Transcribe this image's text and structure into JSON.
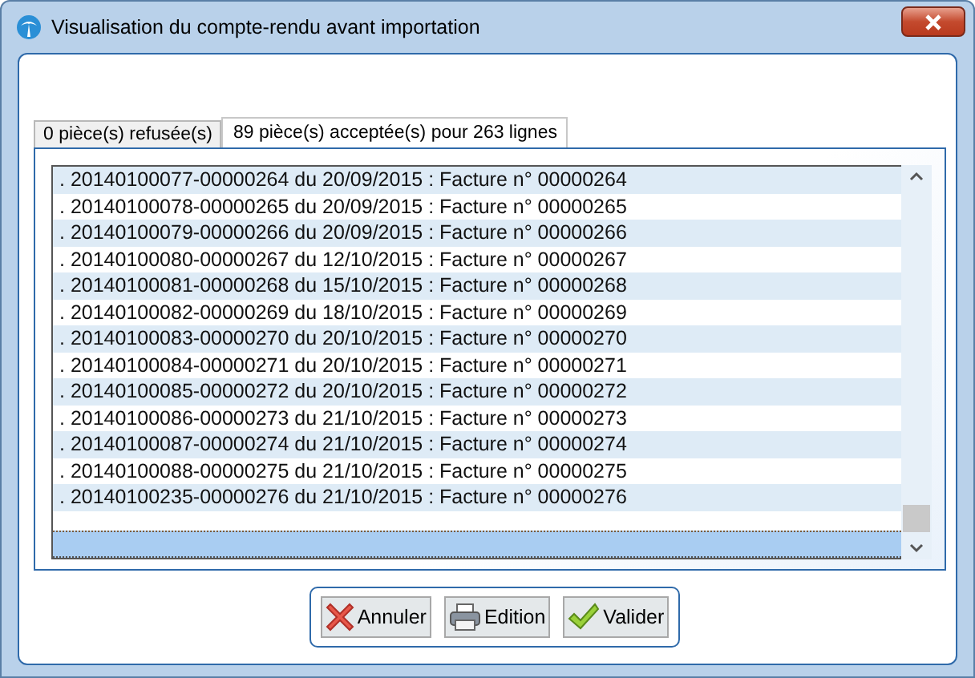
{
  "window": {
    "title": "Visualisation du compte-rendu avant importation"
  },
  "tabs": [
    {
      "label": "0 pièce(s) refusée(s)",
      "selected": false
    },
    {
      "label": "89 pièce(s) acceptée(s) pour 263 lignes",
      "selected": true
    }
  ],
  "list": {
    "rows": [
      {
        "text": ". 20140100077-00000264 du 20/09/2015 : Facture n° 00000264",
        "selected": false
      },
      {
        "text": ". 20140100078-00000265 du 20/09/2015 : Facture n° 00000265",
        "selected": false
      },
      {
        "text": ". 20140100079-00000266 du 20/09/2015 : Facture n° 00000266",
        "selected": false
      },
      {
        "text": ". 20140100080-00000267 du 12/10/2015 : Facture n° 00000267",
        "selected": false
      },
      {
        "text": ". 20140100081-00000268 du 15/10/2015 : Facture n° 00000268",
        "selected": false
      },
      {
        "text": ". 20140100082-00000269 du 18/10/2015 : Facture n° 00000269",
        "selected": false
      },
      {
        "text": ". 20140100083-00000270 du 20/10/2015 : Facture n° 00000270",
        "selected": false
      },
      {
        "text": ". 20140100084-00000271 du 20/10/2015 : Facture n° 00000271",
        "selected": false
      },
      {
        "text": ". 20140100085-00000272 du 20/10/2015 : Facture n° 00000272",
        "selected": false
      },
      {
        "text": ". 20140100086-00000273 du 21/10/2015 : Facture n° 00000273",
        "selected": false
      },
      {
        "text": ". 20140100087-00000274 du 21/10/2015 : Facture n° 00000274",
        "selected": false
      },
      {
        "text": ". 20140100088-00000275 du 21/10/2015 : Facture n° 00000275",
        "selected": false
      },
      {
        "text": ". 20140100235-00000276 du 21/10/2015 : Facture n° 00000276",
        "selected": false
      }
    ],
    "blank_row": {
      "selected": true
    }
  },
  "buttons": [
    {
      "kind": "cancel",
      "label": "Annuler"
    },
    {
      "kind": "print",
      "label": "Edition"
    },
    {
      "kind": "ok",
      "label": "Valider"
    }
  ]
}
